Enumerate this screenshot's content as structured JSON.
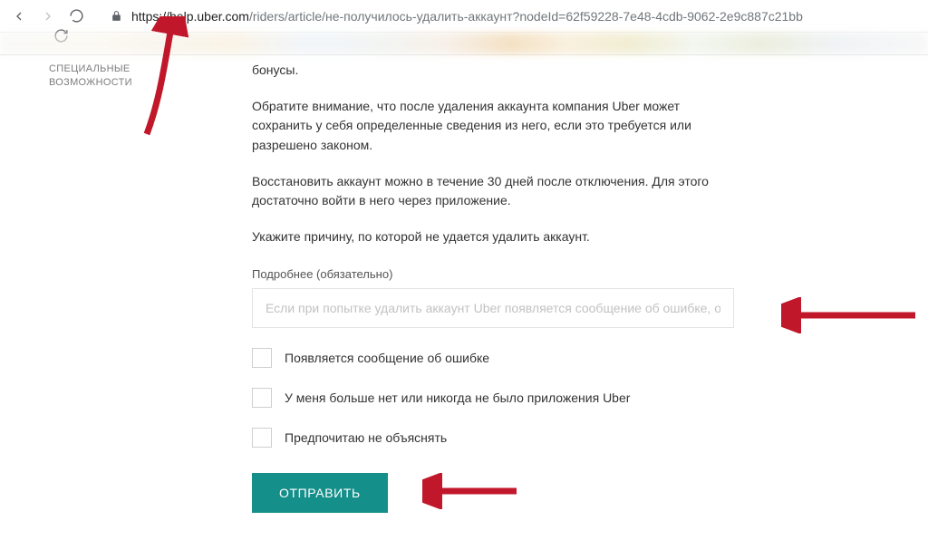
{
  "browser": {
    "url_host": "https://help.uber.com",
    "url_rest": "/riders/article/не-получилось-удалить-аккаунт?nodeId=62f59228-7e48-4cdb-9062-2e9c887c21bb"
  },
  "sidebar": {
    "item1_line1": "СПЕЦИАЛЬНЫЕ",
    "item1_line2": "ВОЗМОЖНОСТИ"
  },
  "main": {
    "p0": "бонусы.",
    "p1": "Обратите внимание, что после удаления аккаунта компания Uber может сохранить у себя определенные сведения из него, если это требуется или разрешено законом.",
    "p2": "Восстановить аккаунт можно в течение 30 дней после отключения. Для этого достаточно войти в него через приложение.",
    "p3": "Укажите причину, по которой не удается удалить аккаунт.",
    "form": {
      "label": "Подробнее (обязательно)",
      "placeholder": "Если при попытке удалить аккаунт Uber появляется сообщение об ошибке, опиши",
      "checkbox1": "Появляется сообщение об ошибке",
      "checkbox2": "У меня больше нет или никогда не было приложения Uber",
      "checkbox3": "Предпочитаю не объяснять",
      "submit": "ОТПРАВИТЬ"
    }
  }
}
